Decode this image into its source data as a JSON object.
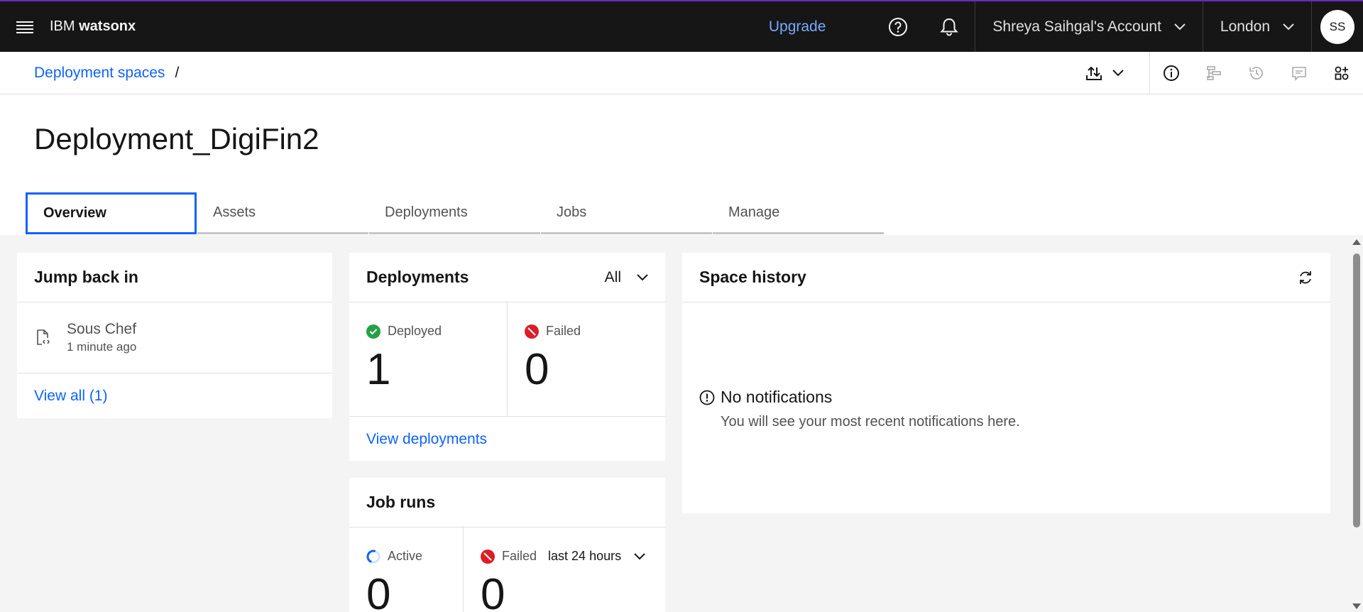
{
  "header": {
    "brand_prefix": "IBM",
    "brand_name": "watsonx",
    "upgrade_label": "Upgrade",
    "account_label": "Shreya Saihgal's Account",
    "region_label": "London",
    "avatar_initials": "SS"
  },
  "breadcrumb": {
    "parent": "Deployment spaces",
    "separator": "/"
  },
  "page": {
    "title": "Deployment_DigiFin2"
  },
  "tabs": [
    {
      "label": "Overview",
      "active": true
    },
    {
      "label": "Assets",
      "active": false
    },
    {
      "label": "Deployments",
      "active": false
    },
    {
      "label": "Jobs",
      "active": false
    },
    {
      "label": "Manage",
      "active": false
    }
  ],
  "jump_back_in": {
    "title": "Jump back in",
    "items": [
      {
        "name": "Sous Chef",
        "time": "1 minute ago"
      }
    ],
    "view_all": "View all (1)"
  },
  "deployments_card": {
    "title": "Deployments",
    "filter_value": "All",
    "deployed_label": "Deployed",
    "deployed_count": "1",
    "failed_label": "Failed",
    "failed_count": "0",
    "view_link": "View deployments"
  },
  "job_runs": {
    "title": "Job runs",
    "active_label": "Active",
    "active_count": "0",
    "failed_label": "Failed",
    "period_value": "last 24 hours",
    "failed_count": "0"
  },
  "space_history": {
    "title": "Space history",
    "empty_title": "No notifications",
    "empty_subtitle": "You will see your most recent notifications here."
  },
  "colors": {
    "header_bg": "#161616",
    "accent_top": "#6929c4",
    "link": "#0f62fe",
    "upgrade": "#78a9ff",
    "success": "#24a148",
    "error": "#da1e28",
    "content_bg": "#f4f4f4"
  }
}
